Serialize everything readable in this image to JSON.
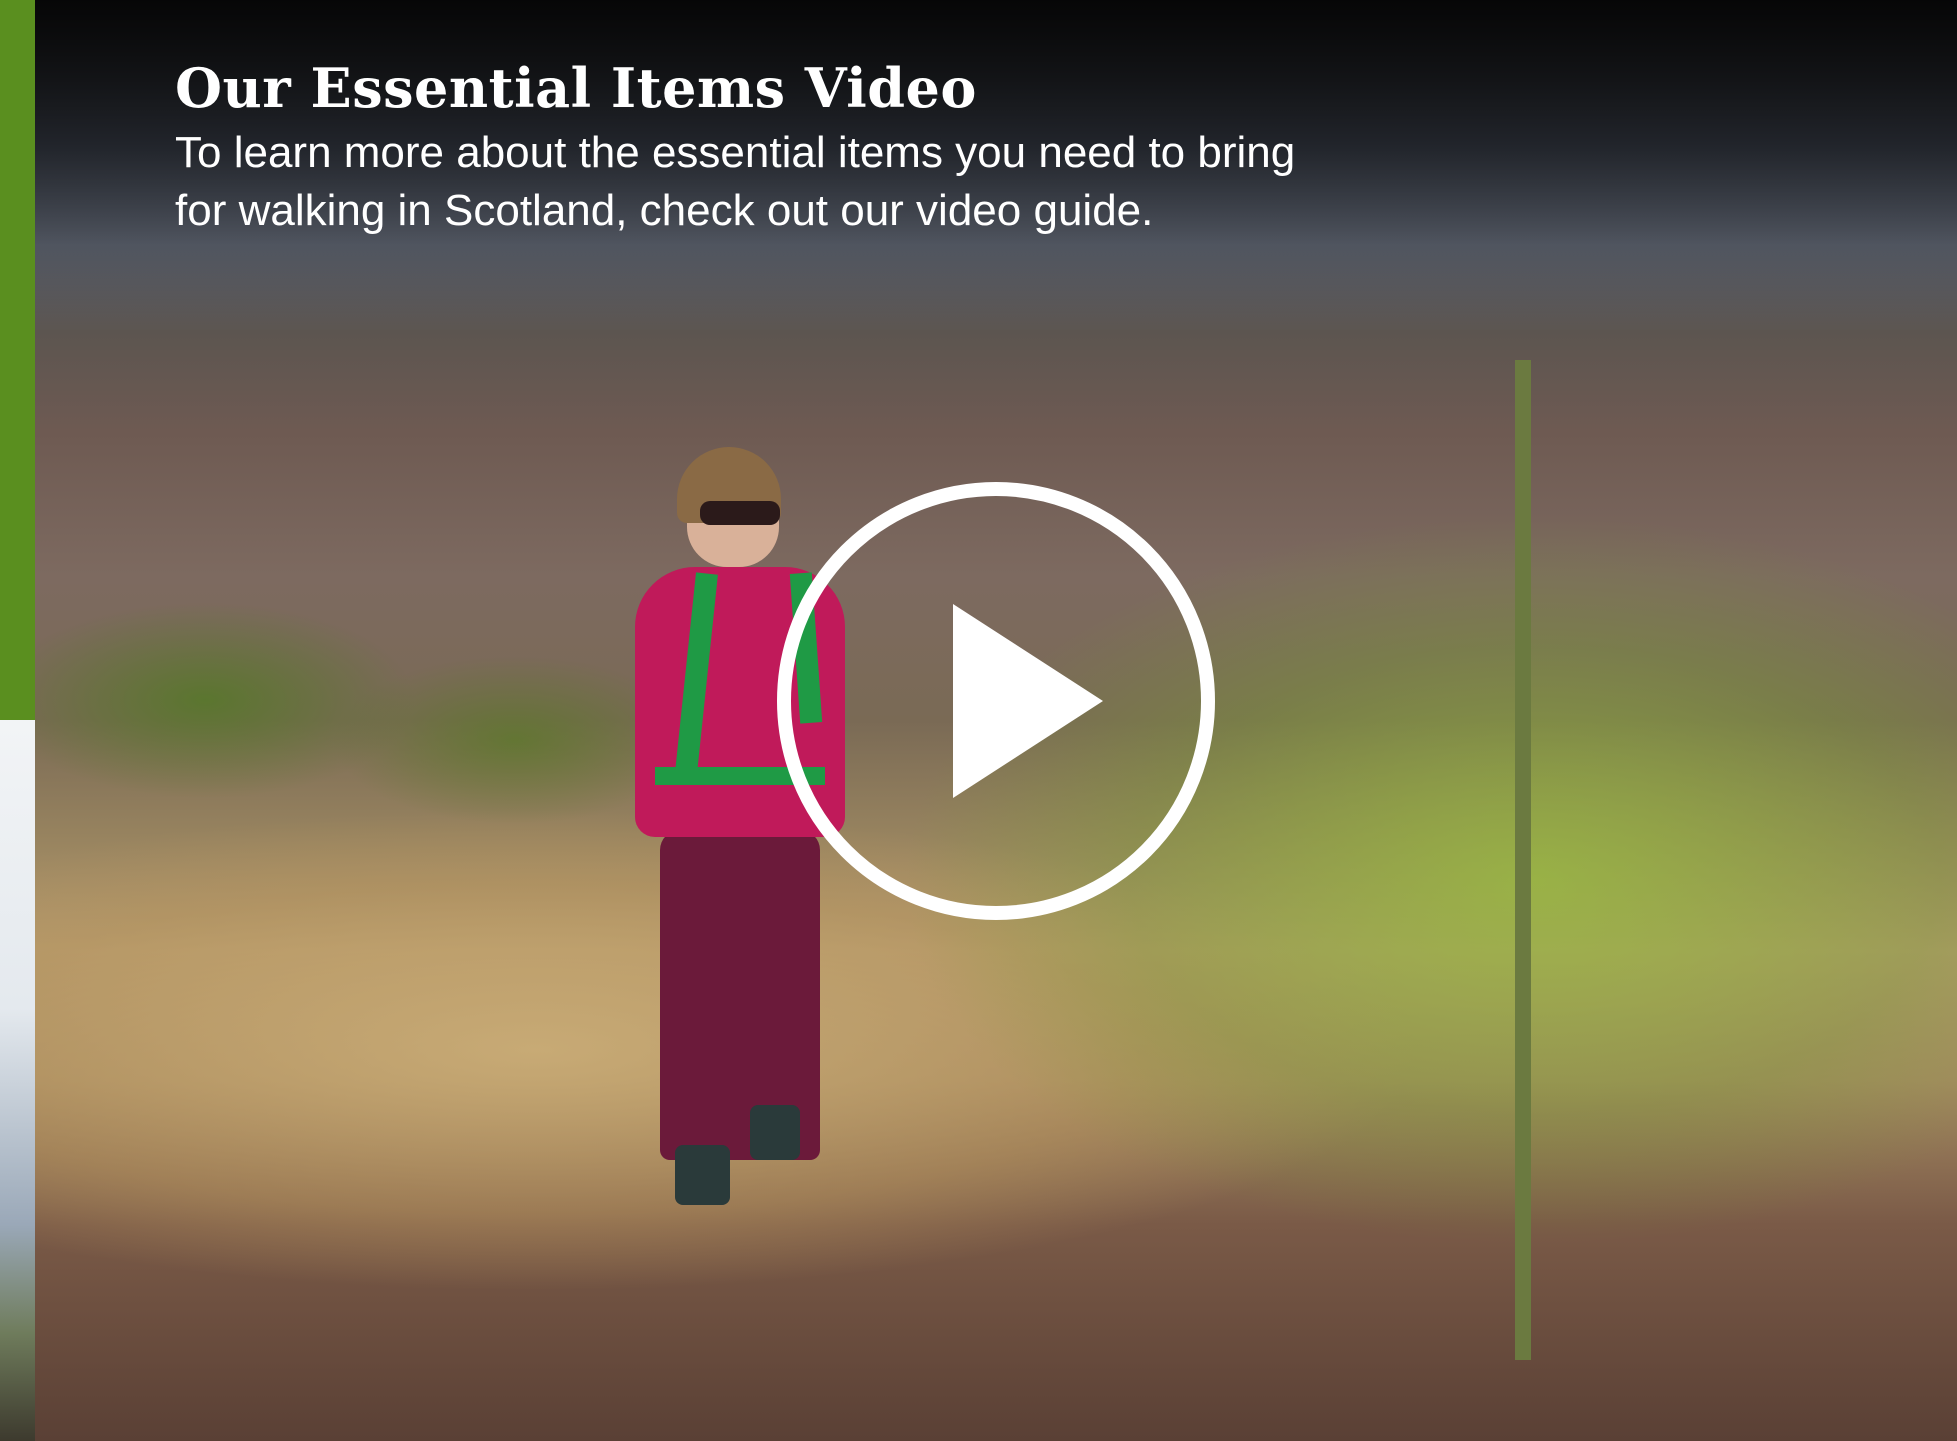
{
  "video_card": {
    "title": "Our Essential Items Video",
    "description": "To learn more about the essential items you need to bring for walking in Scotland, check out our video guide."
  },
  "icons": {
    "play": "play-icon"
  },
  "colors": {
    "accent": "#5a8f1f",
    "text": "#ffffff"
  }
}
